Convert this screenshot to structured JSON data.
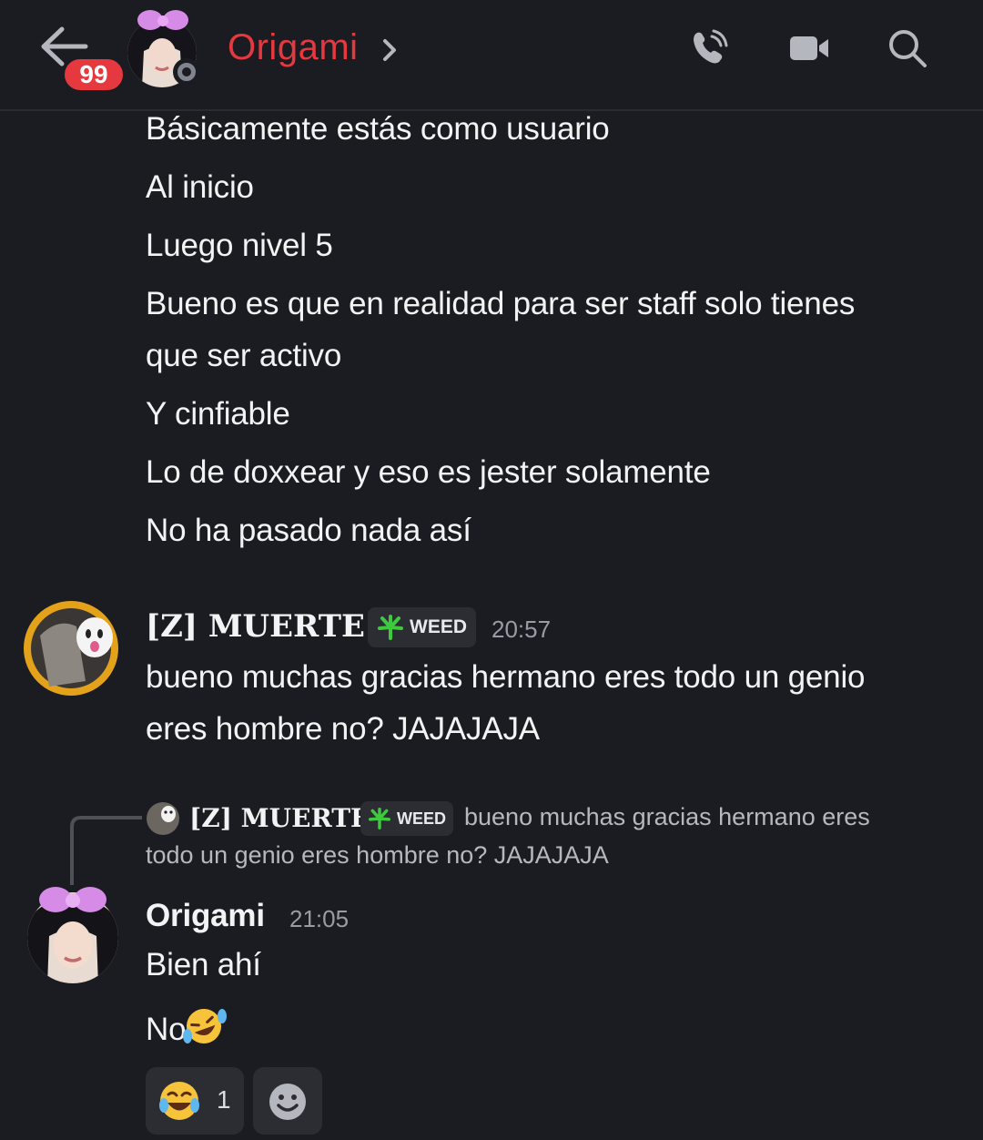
{
  "header": {
    "unread_count": "99",
    "channel_name": "Origami"
  },
  "messages_top": [
    "Básicamente estás como usuario",
    "Al inicio",
    "Luego nivel 5",
    "Bueno es que en realidad para ser staff solo tienes",
    "que ser activo",
    "Y cinfiable",
    "Lo de doxxear y eso es jester solamente",
    "No ha pasado nada así"
  ],
  "muerte_message": {
    "username": "[Z] MUERTE",
    "tag": "WEED",
    "timestamp": "20:57",
    "lines": [
      "bueno muchas gracias hermano eres todo un genio",
      "eres hombre no? JAJAJAJA"
    ]
  },
  "reply": {
    "username": "[Z] MUERTE",
    "tag": "WEED",
    "lines": [
      "bueno muchas gracias hermano eres",
      "todo un genio eres hombre no? JAJAJAJA"
    ]
  },
  "origami_message": {
    "username": "Origami",
    "timestamp": "21:05",
    "lines": [
      "Bien ahí",
      "No"
    ]
  },
  "reactions": [
    {
      "emoji": "joy",
      "count": "1"
    }
  ],
  "colors": {
    "background": "#1b1c21",
    "accent_red": "#e5393f",
    "tag_bg": "#2b2d33",
    "muted": "#9a9ca5"
  }
}
